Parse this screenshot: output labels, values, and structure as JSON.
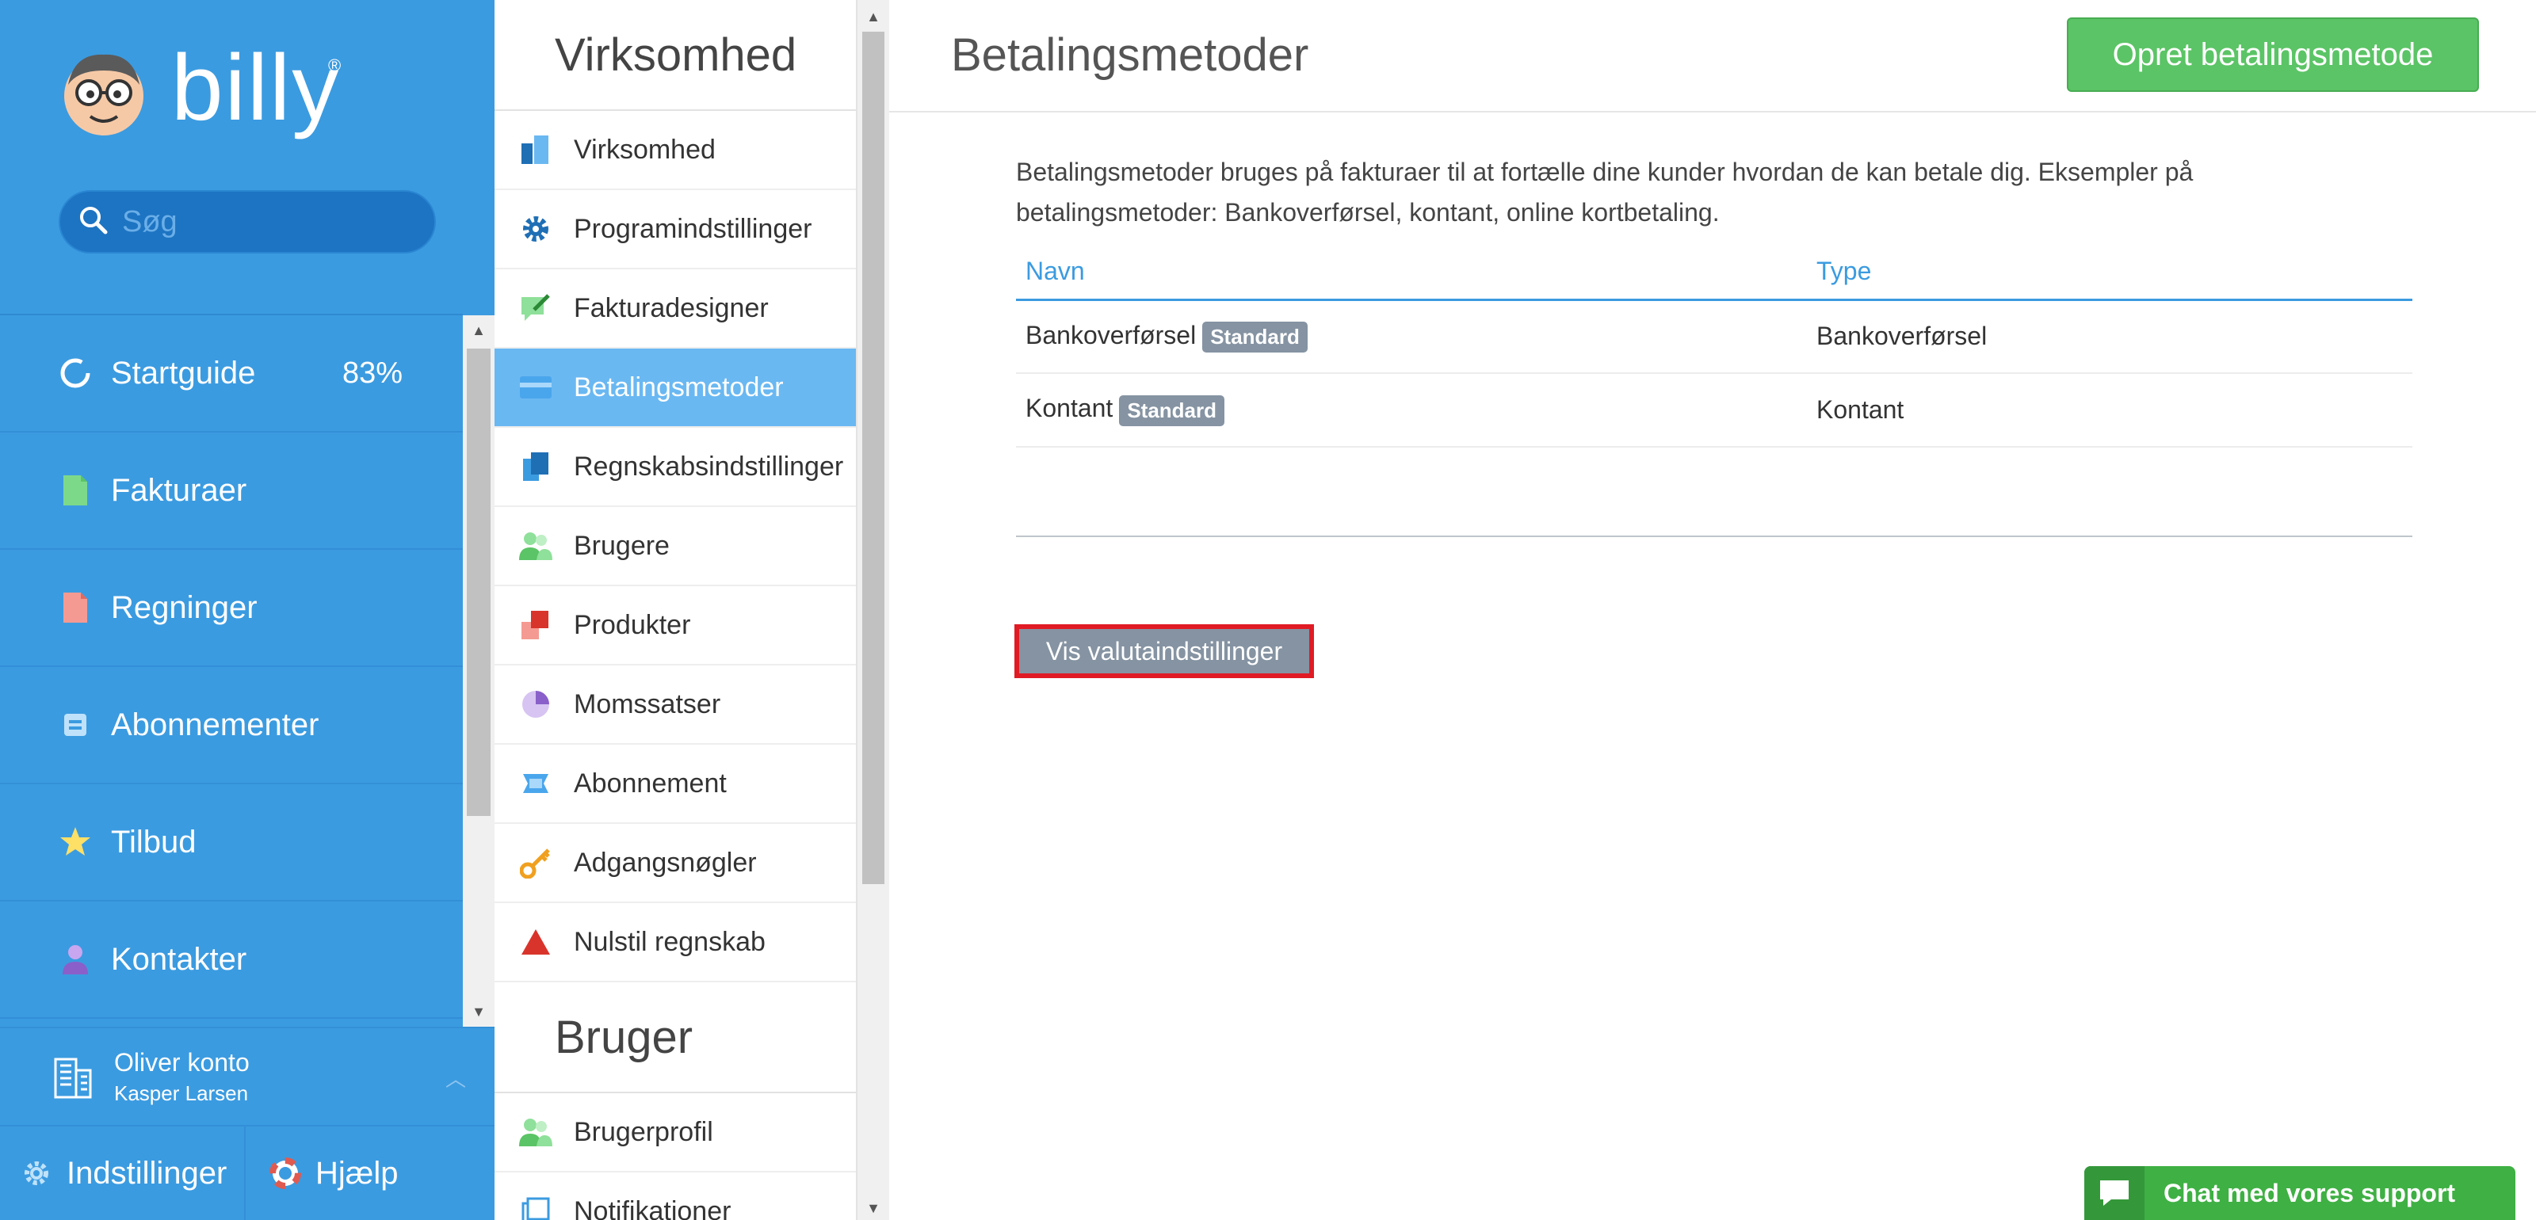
{
  "brand": {
    "name": "billy",
    "reg": "®"
  },
  "search": {
    "placeholder": "Søg"
  },
  "nav": {
    "items": [
      {
        "label": "Startguide",
        "icon": "progress-circle-icon",
        "badge": "83%"
      },
      {
        "label": "Fakturaer",
        "icon": "invoice-icon"
      },
      {
        "label": "Regninger",
        "icon": "bill-icon"
      },
      {
        "label": "Abonnementer",
        "icon": "subscription-icon"
      },
      {
        "label": "Tilbud",
        "icon": "star-icon"
      },
      {
        "label": "Kontakter",
        "icon": "person-icon"
      }
    ]
  },
  "account": {
    "name": "Oliver konto",
    "user": "Kasper Larsen",
    "icon": "building-icon"
  },
  "bottom": {
    "settings": "Indstillinger",
    "help": "Hjælp"
  },
  "settings_menu": {
    "section1_title": "Virksomhed",
    "items": [
      {
        "label": "Virksomhed",
        "icon": "company-icon",
        "color": "#3b9be0"
      },
      {
        "label": "Programindstillinger",
        "icon": "gear-icon",
        "color": "#1f6fb5"
      },
      {
        "label": "Fakturadesigner",
        "icon": "invoice-design-icon",
        "color": "#5bc466"
      },
      {
        "label": "Betalingsmetoder",
        "icon": "credit-card-icon",
        "color": "#3b9be0",
        "active": true
      },
      {
        "label": "Regnskabsindstillinger",
        "icon": "accounting-icon",
        "color": "#3b9be0"
      },
      {
        "label": "Brugere",
        "icon": "users-icon",
        "color": "#5bc466"
      },
      {
        "label": "Produkter",
        "icon": "products-icon",
        "color": "#e06a60"
      },
      {
        "label": "Momssatser",
        "icon": "pie-chart-icon",
        "color": "#a98bd8"
      },
      {
        "label": "Abonnement",
        "icon": "subscription-icon",
        "color": "#3b9be0"
      },
      {
        "label": "Adgangsnøgler",
        "icon": "key-icon",
        "color": "#f0a020"
      },
      {
        "label": "Nulstil regnskab",
        "icon": "warning-triangle-icon",
        "color": "#d9342b"
      }
    ],
    "section2_title": "Bruger",
    "items2": [
      {
        "label": "Brugerprofil",
        "icon": "user-profile-icon",
        "color": "#5bc466"
      },
      {
        "label": "Notifikationer",
        "icon": "notifications-icon",
        "color": "#3b9be0"
      }
    ]
  },
  "main": {
    "title": "Betalingsmetoder",
    "create_button": "Opret betalingsmetode",
    "intro": "Betalingsmetoder bruges på fakturaer til at fortælle dine kunder hvordan de kan betale dig. Eksempler på betalingsmetoder: Bankoverførsel, kontant, online kortbetaling.",
    "table": {
      "headers": [
        "Navn",
        "Type"
      ],
      "rows": [
        {
          "name": "Bankoverførsel",
          "badge": "Standard",
          "type": "Bankoverførsel"
        },
        {
          "name": "Kontant",
          "badge": "Standard",
          "type": "Kontant"
        }
      ]
    },
    "currency_button": "Vis valutaindstillinger"
  },
  "chat": {
    "label": "Chat med vores support",
    "icon": "chat-bubble-icon"
  },
  "colors": {
    "sidebar": "#3b9be0",
    "active_menu": "#6ab8f2",
    "primary_button": "#5bc466",
    "badge": "#8593a2",
    "highlight": "#e01b24"
  }
}
